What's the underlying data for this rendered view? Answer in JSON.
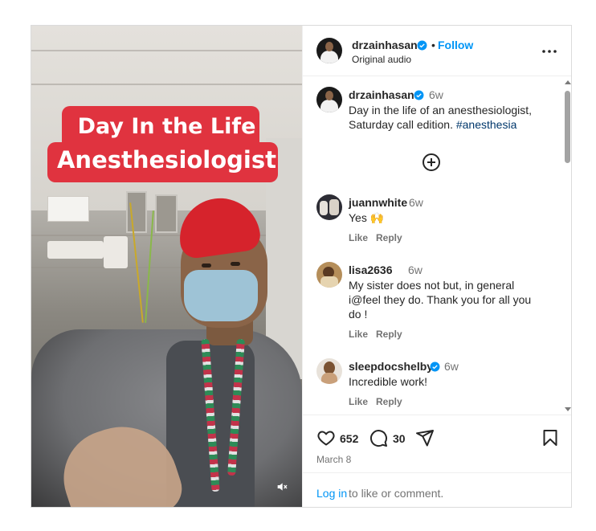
{
  "post": {
    "caption_line1": "Day In the Life",
    "caption_line2": "Anesthesiologist"
  },
  "header": {
    "username": "drzainhasan",
    "separator": "•",
    "follow_label": "Follow",
    "audio_label": "Original audio"
  },
  "owner_comment": {
    "username": "drzainhasan",
    "time": "6w",
    "text": "Day in the life of an anesthesiologist, Saturday call edition.",
    "hashtag": "#anesthesia"
  },
  "comments": [
    {
      "username": "juannwhite",
      "time": "6w",
      "text": "Yes 🙌",
      "like_label": "Like",
      "reply_label": "Reply"
    },
    {
      "username": "lisa2636",
      "time": "6w",
      "text": "My sister does not but, in general i@feel they do. Thank you for all you do !",
      "like_label": "Like",
      "reply_label": "Reply"
    },
    {
      "username": "sleepdocshelby",
      "time": "6w",
      "text": "Incredible work!",
      "like_label": "Like",
      "reply_label": "Reply",
      "verified": true
    }
  ],
  "actions": {
    "likes_count": "652",
    "comments_count": "30",
    "date": "March 8",
    "icons": [
      "heart-icon",
      "comment-icon",
      "share-icon",
      "bookmark-icon"
    ]
  },
  "footer": {
    "login_label": "Log in",
    "login_rest": "to like or comment."
  },
  "colors": {
    "accent": "#0095f6",
    "caption_bg": "#e0333f",
    "text_secondary": "#737373",
    "border": "#dbdbdb"
  }
}
